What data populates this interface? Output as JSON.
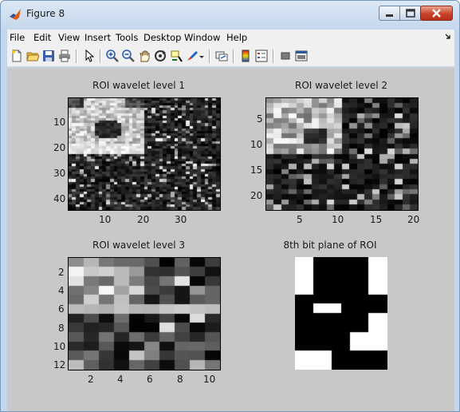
{
  "window": {
    "title": "Figure 8",
    "controls": [
      "minimize",
      "maximize",
      "close"
    ]
  },
  "menubar": {
    "items": [
      "File",
      "Edit",
      "View",
      "Insert",
      "Tools",
      "Desktop",
      "Window",
      "Help"
    ]
  },
  "toolbar": {
    "icons": [
      "new-figure-icon",
      "open-file-icon",
      "save-icon",
      "print-icon",
      "pointer-icon",
      "zoom-in-icon",
      "zoom-out-icon",
      "pan-icon",
      "rotate-3d-icon",
      "data-cursor-icon",
      "brush-icon",
      "link-plot-icon",
      "colorbar-icon",
      "legend-icon",
      "hide-plot-tools-icon",
      "show-plot-tools-icon"
    ]
  },
  "figure": {
    "background": "#c8c8c8",
    "axes": [
      {
        "title": "ROI wavelet level 1",
        "xticks": [
          "10",
          "20",
          "30"
        ],
        "yticks": [
          "10",
          "20",
          "30",
          "40"
        ],
        "rows": 44,
        "cols": 40,
        "content": "noisy grayscale wavelet decomposition with bright approximation sub-band in the top-left quadrant"
      },
      {
        "title": "ROI wavelet level 2",
        "xticks": [
          "5",
          "10",
          "15",
          "20"
        ],
        "yticks": [
          "5",
          "10",
          "15",
          "20"
        ],
        "rows": 22,
        "cols": 20
      },
      {
        "title": "ROI wavelet level 3",
        "xticks": [
          "2",
          "4",
          "6",
          "8",
          "10"
        ],
        "yticks": [
          "2",
          "4",
          "6",
          "8",
          "10",
          "12"
        ],
        "rows": 12,
        "cols": 10
      },
      {
        "title": "8th bit plane of ROI",
        "xticks": [],
        "yticks": [],
        "rows": 12,
        "cols": 10,
        "colors": [
          "#000000",
          "#ffffff"
        ]
      }
    ]
  }
}
